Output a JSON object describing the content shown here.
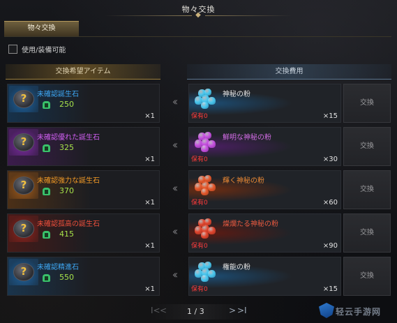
{
  "window": {
    "title": "物々交換"
  },
  "tab": {
    "label": "物々交換"
  },
  "filter": {
    "label": "使用/装備可能",
    "checked": false
  },
  "columns": {
    "wanted": "交換希望アイテム",
    "cost": "交換費用"
  },
  "exchange_label": "交換",
  "rows": [
    {
      "want_name": "未確認誕生石",
      "want_color": "#3ea8f5",
      "want_level": "250",
      "want_qty": "×1",
      "cost_name": "神秘の粉",
      "cost_color": "#e6e6e6",
      "owned": "保有0",
      "cost_qty": "×15",
      "frame_color": "#1f6fb5",
      "gem_color": "#47c6ee",
      "cost_glow": "#1c4d74"
    },
    {
      "want_name": "未確認優れた誕生石",
      "want_color": "#d05ff2",
      "want_level": "325",
      "want_qty": "×1",
      "cost_name": "鮮明な神秘の粉",
      "cost_color": "#d36de6",
      "owned": "保有0",
      "cost_qty": "×30",
      "frame_color": "#8c2fb8",
      "gem_color": "#c64fe0",
      "cost_glow": "#4b1e63"
    },
    {
      "want_name": "未確認強力な誕生石",
      "want_color": "#f29a26",
      "want_level": "370",
      "want_qty": "×1",
      "cost_name": "輝く神秘の粉",
      "cost_color": "#ee8a34",
      "owned": "保有0",
      "cost_qty": "×60",
      "frame_color": "#b8661a",
      "gem_color": "#e5572a",
      "cost_glow": "#6a2c12"
    },
    {
      "want_name": "未確認孤高の誕生石",
      "want_color": "#f0503c",
      "want_level": "415",
      "want_qty": "×1",
      "cost_name": "燦爛たる神秘の粉",
      "cost_color": "#ef5a3f",
      "owned": "保有0",
      "cost_qty": "×90",
      "frame_color": "#a3241c",
      "gem_color": "#e0442c",
      "cost_glow": "#5e1a12"
    },
    {
      "want_name": "未確認精進石",
      "want_color": "#3ea8f5",
      "want_level": "550",
      "want_qty": "×1",
      "cost_name": "権能の粉",
      "cost_color": "#e6e6e6",
      "owned": "保有0",
      "cost_qty": "×15",
      "frame_color": "#1f6fb5",
      "gem_color": "#47c6ee",
      "cost_glow": "#1c4d74"
    }
  ],
  "pager": {
    "first": "I<",
    "prev": "<",
    "text": "1 / 3",
    "next": ">",
    "last": ">I"
  },
  "watermark": {
    "text": "轻云手游网"
  },
  "icons": {
    "arrow": "double-chevron-left-icon",
    "want_item": "question-stone-icon",
    "cost_item": "powder-pile-icon",
    "level": "helmet-icon"
  }
}
